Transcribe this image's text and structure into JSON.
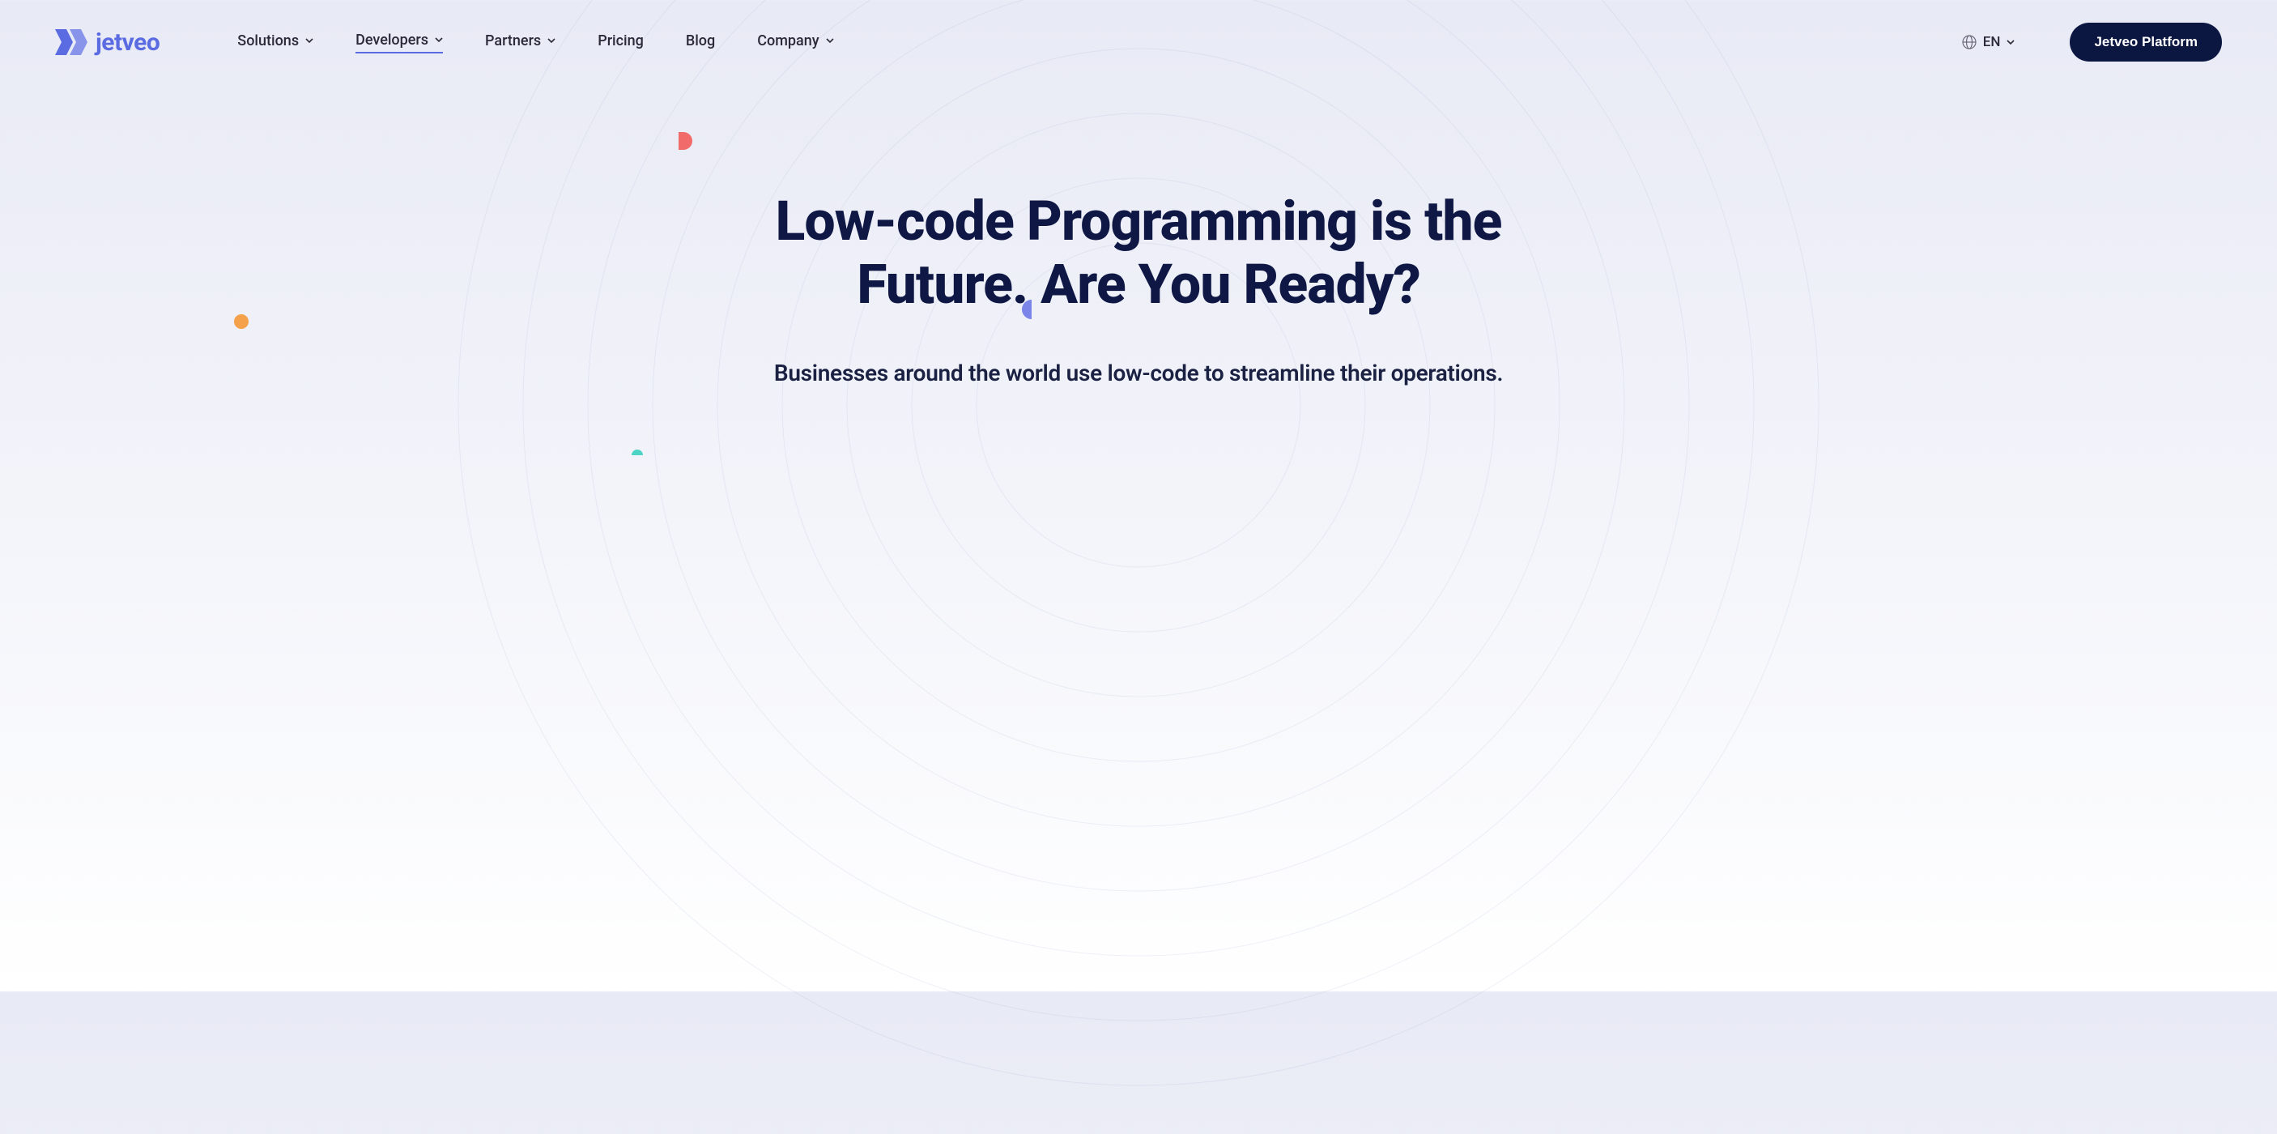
{
  "brand": {
    "name": "jetveo"
  },
  "nav": {
    "items": [
      {
        "label": "Solutions",
        "hasDropdown": true,
        "active": false
      },
      {
        "label": "Developers",
        "hasDropdown": true,
        "active": true
      },
      {
        "label": "Partners",
        "hasDropdown": true,
        "active": false
      },
      {
        "label": "Pricing",
        "hasDropdown": false,
        "active": false
      },
      {
        "label": "Blog",
        "hasDropdown": false,
        "active": false
      },
      {
        "label": "Company",
        "hasDropdown": true,
        "active": false
      }
    ]
  },
  "language": {
    "current": "EN"
  },
  "cta": {
    "label": "Jetveo Platform"
  },
  "hero": {
    "title": "Low-code Programming is the Future. Are You Ready?",
    "subtitle": "Businesses around the world use low-code to streamline their operations."
  }
}
